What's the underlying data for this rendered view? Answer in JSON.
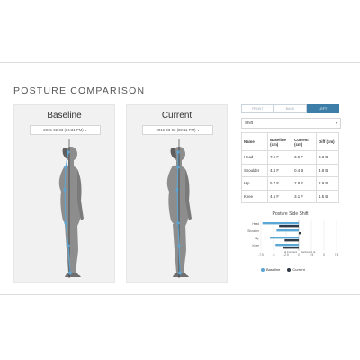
{
  "page": {
    "title": "POSTURE COMPARISON"
  },
  "panels": {
    "baseline": {
      "label": "Baseline",
      "date": "2015-02-03 (04:31 PM)",
      "caret": "▾"
    },
    "current": {
      "label": "Current",
      "date": "2016-03-03 (02:11 PM)",
      "caret": "▾"
    }
  },
  "tabs": [
    {
      "label": "FRONT",
      "active": false
    },
    {
      "label": "BACK",
      "active": false
    },
    {
      "label": "LEFT",
      "active": true
    }
  ],
  "measure_select": {
    "value": "Shift",
    "caret": "▾"
  },
  "table": {
    "headers": [
      "Name",
      "Baseline (cm)",
      "Current (cm)",
      "Diff (cm)"
    ],
    "rows": [
      [
        "Head",
        "7.2 F",
        "3.9 F",
        "3.3 B"
      ],
      [
        "Shoulder",
        "4.4 F",
        "0.4 B",
        "4.8 B"
      ],
      [
        "Hip",
        "5.7 F",
        "2.8 F",
        "2.9 B"
      ],
      [
        "Knee",
        "4.6 F",
        "3.1 F",
        "1.5 B"
      ]
    ]
  },
  "chart_data": {
    "type": "bar",
    "title": "Posture Side Shift",
    "categories": [
      "Head",
      "Shoulder",
      "Hip",
      "Knee"
    ],
    "series": [
      {
        "name": "Baseline",
        "values": [
          -7.2,
          -4.4,
          -5.7,
          -4.6
        ],
        "color": "#5aa7d6"
      },
      {
        "name": "Current",
        "values": [
          -3.9,
          0.4,
          -2.8,
          -3.1
        ],
        "color": "#2f3a44"
      }
    ],
    "xlim": [
      -7.5,
      7.5
    ],
    "x_ticks": [
      "-7.5",
      "-5",
      "-2.5",
      "0",
      "2.5",
      "5",
      "7.5"
    ],
    "axis_labels": {
      "left": "◄ Forward",
      "right": "Backward ►"
    },
    "legend_placement": "bottom"
  },
  "colors": {
    "accent": "#3c7ea8",
    "baseline": "#5aa7d6",
    "current": "#2f3a44"
  }
}
